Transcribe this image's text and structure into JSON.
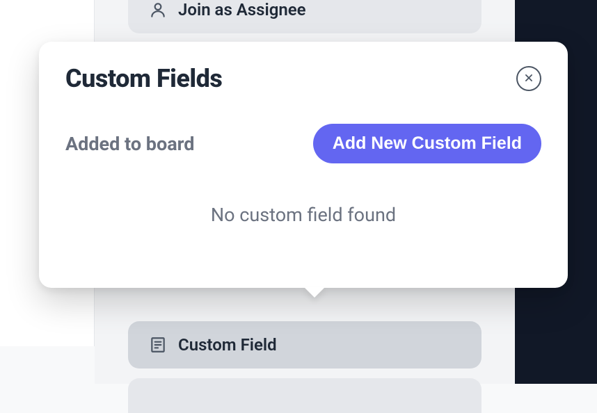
{
  "list": {
    "join_assignee_label": "Join as Assignee",
    "custom_field_label": "Custom Field"
  },
  "popover": {
    "title": "Custom Fields",
    "toolbar_label": "Added to board",
    "add_button_label": "Add New Custom Field",
    "empty_message": "No custom field found"
  }
}
